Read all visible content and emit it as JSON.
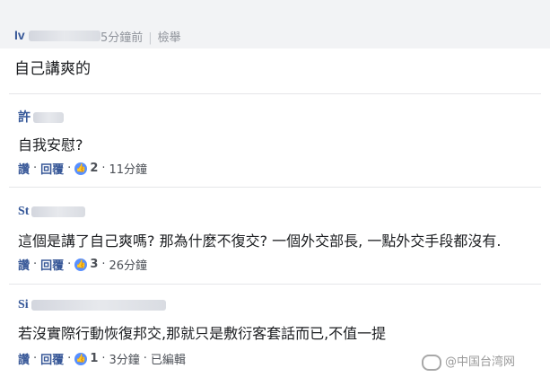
{
  "comments": [
    {
      "name": "Iv",
      "time": "5分鐘前",
      "report": "檢舉",
      "text": "自己講爽的"
    },
    {
      "name": "許",
      "text": "自我安慰?",
      "like_label": "讚",
      "reply_label": "回覆",
      "likes": "2",
      "time": "11分鐘"
    },
    {
      "name": "St",
      "text": "這個是講了自己爽嗎? 那為什麼不復交? 一個外交部長, 一點外交手段都沒有.",
      "like_label": "讚",
      "reply_label": "回覆",
      "likes": "3",
      "time": "26分鐘"
    },
    {
      "name": "Si",
      "text": "若沒實際行動恢復邦交,那就只是敷衍客套話而已,不值一提",
      "like_label": "讚",
      "reply_label": "回覆",
      "likes": "1",
      "time": "3分鐘",
      "edited": "已編輯"
    }
  ],
  "watermark": "@中国台湾网",
  "colors": {
    "name": "#385898",
    "like_badge": "#5890ff",
    "topbar": "#f2f3f5"
  },
  "icons": {
    "like": "thumbs-up-icon",
    "watermark": "weibo-icon"
  }
}
